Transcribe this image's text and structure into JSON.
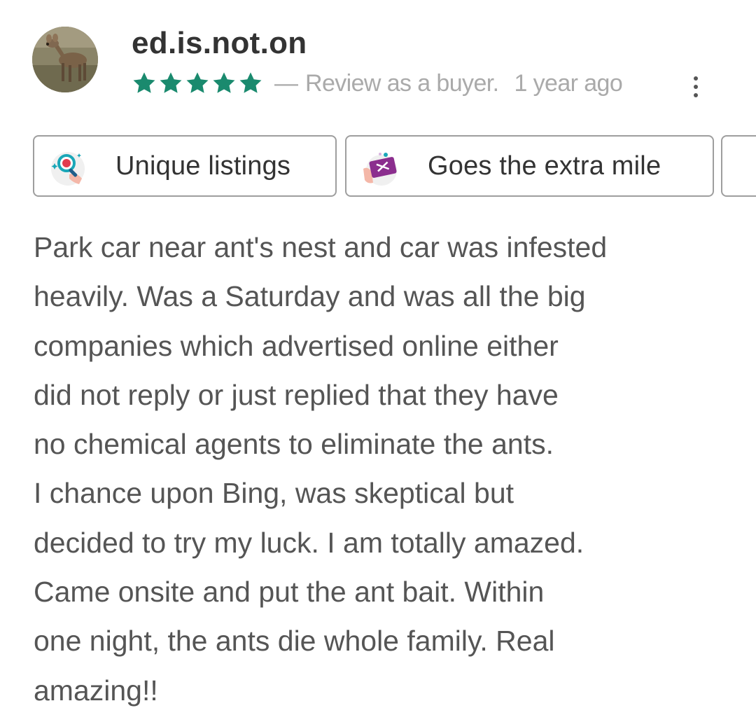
{
  "review": {
    "username": "ed.is.not.on",
    "rating": 5,
    "rating_max": 5,
    "dash": "—",
    "review_type": "Review as a buyer.",
    "time_ago": "1 year ago",
    "tags": [
      {
        "label": "Unique listings",
        "icon": "magnifier-sparkle-icon"
      },
      {
        "label": "Goes the extra mile",
        "icon": "gift-card-hand-icon"
      }
    ],
    "text_lines": [
      "Park car near ant's nest and car was infested",
      "heavily. Was a Saturday and was all the big",
      "companies which advertised online either",
      "did not reply or just replied that they have",
      "no chemical agents to eliminate the ants.",
      "I chance upon Bing, was skeptical but",
      "decided to try my luck. I am totally amazed.",
      "Came onsite and put the ant bait. Within",
      "one night, the ants die whole family. Real",
      "amazing!!"
    ]
  },
  "colors": {
    "star": "#1a8a6e",
    "meta_text": "#aaaaaa",
    "body_text": "#555555",
    "tag_border": "#9e9e9e"
  }
}
